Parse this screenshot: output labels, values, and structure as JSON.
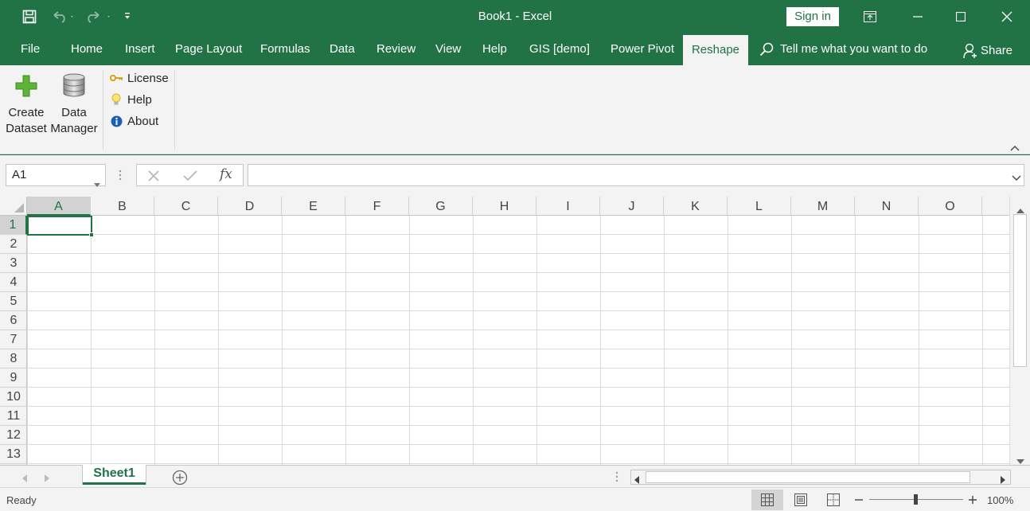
{
  "window": {
    "title": "Book1  -  Excel",
    "sign_in": "Sign in"
  },
  "tabs": [
    {
      "label": "File"
    },
    {
      "label": "Home"
    },
    {
      "label": "Insert"
    },
    {
      "label": "Page Layout"
    },
    {
      "label": "Formulas"
    },
    {
      "label": "Data"
    },
    {
      "label": "Review"
    },
    {
      "label": "View"
    },
    {
      "label": "Help"
    },
    {
      "label": "GIS [demo]"
    },
    {
      "label": "Power Pivot"
    },
    {
      "label": "Reshape"
    }
  ],
  "active_tab": "Reshape",
  "tell_me": "Tell me what you want to do",
  "share": "Share",
  "ribbon": {
    "create_dataset": {
      "line1": "Create",
      "line2": "Dataset"
    },
    "data_manager": {
      "line1": "Data",
      "line2": "Manager"
    },
    "license": "License",
    "help": "Help",
    "about": "About"
  },
  "formula_bar": {
    "name_box": "A1",
    "fx": "fx",
    "formula": ""
  },
  "columns": [
    "A",
    "B",
    "C",
    "D",
    "E",
    "F",
    "G",
    "H",
    "I",
    "J",
    "K",
    "L",
    "M",
    "N",
    "O"
  ],
  "rows": [
    "1",
    "2",
    "3",
    "4",
    "5",
    "6",
    "7",
    "8",
    "9",
    "10",
    "11",
    "12",
    "13"
  ],
  "selected_cell": "A1",
  "sheets": [
    {
      "name": "Sheet1",
      "active": true
    }
  ],
  "status": {
    "ready": "Ready",
    "zoom": "100%"
  },
  "colors": {
    "accent": "#217346",
    "ribbon_bg": "#f3f3f3"
  }
}
